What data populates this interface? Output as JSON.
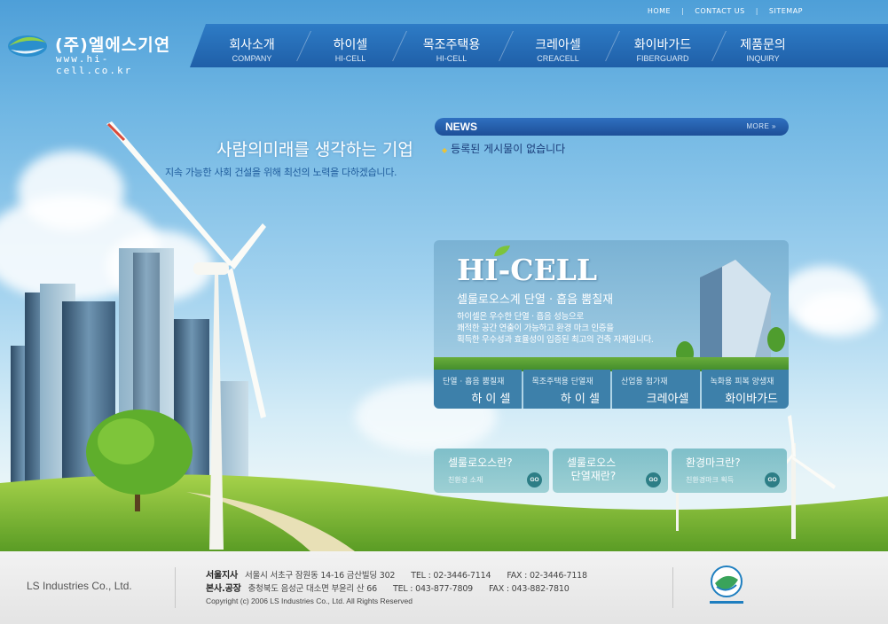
{
  "top_links": [
    "HOME",
    "CONTACT US",
    "SITEMAP"
  ],
  "logo": {
    "name": "(주)엘에스기연",
    "url": "www.hi-cell.co.kr"
  },
  "nav": [
    {
      "ko": "회사소개",
      "en": "COMPANY"
    },
    {
      "ko": "하이셀",
      "en": "HI-CELL"
    },
    {
      "ko": "목조주택용",
      "en": "HI-CELL"
    },
    {
      "ko": "크레아셀",
      "en": "CREACELL"
    },
    {
      "ko": "화이바가드",
      "en": "FIBERGUARD"
    },
    {
      "ko": "제품문의",
      "en": "INQUIRY"
    }
  ],
  "slogan": {
    "main": "사람의미래를 생각하는 기업",
    "sub": "지속 가능한 사회 건설을 위해  최선의 노력을 다하겠습니다."
  },
  "news": {
    "title": "NEWS",
    "more": "MORE »",
    "empty_message": "등록된 게시물이 없습니다"
  },
  "promo": {
    "logo": "HI-CELL",
    "heading": "셀룰로오스계 단열 · 흡음 뿜칠재",
    "desc_lines": [
      "하이셀은 우수한 단열 · 흡음 성능으로",
      "쾌적한 공간 연출이 가능하고 환경 마크 인증을",
      "획득한 우수성과 효율성이 입증된 최고의 건축 자재입니다."
    ],
    "tabs": [
      {
        "sub": "단열 · 흡음 뿜칠재",
        "main": "하 이 셀"
      },
      {
        "sub": "목조주택용 단열재",
        "main": "하 이 셀"
      },
      {
        "sub": "산업용 첨가재",
        "main": "크레아셀"
      },
      {
        "sub": "녹화용 피복 양생재",
        "main": "화이바가드"
      }
    ]
  },
  "info_buttons": [
    {
      "title": "셀룰로오스란?",
      "subtitle": "친환경 소재",
      "go": "GO"
    },
    {
      "title": "셀룰로오스\n단열재란?",
      "subtitle": "",
      "go": "GO"
    },
    {
      "title": "환경마크란?",
      "subtitle": "친환경마크 획득",
      "go": "GO"
    }
  ],
  "footer": {
    "company": "LS Industries Co., Ltd.",
    "seoul": {
      "label": "서울지사",
      "address": "서울시 서초구 잠원동 14-16 금산빌딩 302",
      "tel": "TEL : 02-3446-7114",
      "fax": "FAX : 02-3446-7118"
    },
    "factory": {
      "label": "본사.공장",
      "address": "충청북도 음성군 대소면 부윤리 산 66",
      "tel": "TEL : 043-877-7809",
      "fax": "FAX :  043-882-7810"
    },
    "copyright": "Copyright (c) 2006 LS Industries Co., Ltd.  All Rights Reserved"
  },
  "colors": {
    "nav_bg": "#1f5fa8",
    "news_bar": "#2f70c0",
    "promo_tab": "#3d80aa",
    "info_button": "#8cc7ce",
    "footer_bg": "#ececec"
  }
}
